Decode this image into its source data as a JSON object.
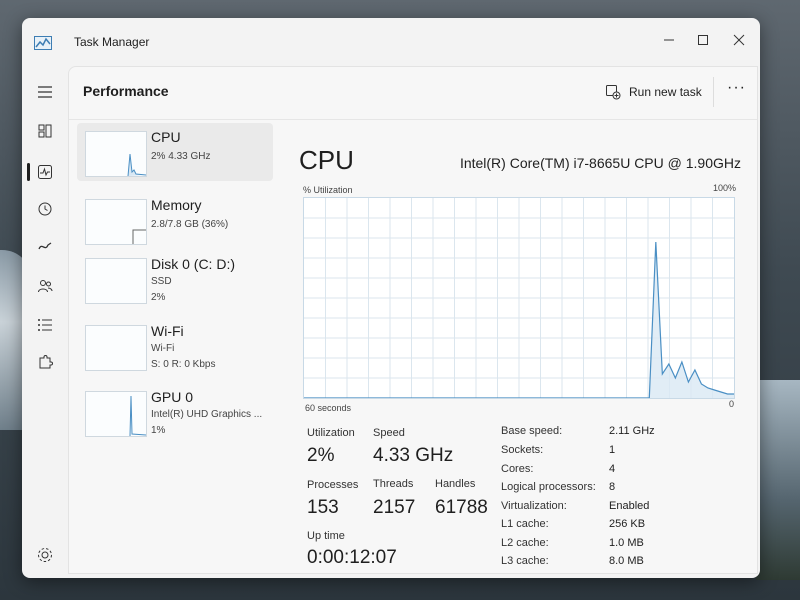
{
  "window": {
    "title": "Task Manager"
  },
  "command_bar": {
    "page_title": "Performance",
    "run_new_task": "Run new task",
    "more": "···"
  },
  "devices": [
    {
      "name": "CPU",
      "sub1": "2% 4.33 GHz",
      "sub2": "",
      "selected": true
    },
    {
      "name": "Memory",
      "sub1": "2.8/7.8 GB (36%)",
      "sub2": ""
    },
    {
      "name": "Disk 0 (C: D:)",
      "sub1": "SSD",
      "sub2": "2%"
    },
    {
      "name": "Wi-Fi",
      "sub1": "Wi-Fi",
      "sub2": "S: 0 R: 0 Kbps"
    },
    {
      "name": "GPU 0",
      "sub1": "Intel(R) UHD Graphics ...",
      "sub2": "1%"
    }
  ],
  "detail": {
    "title": "CPU",
    "model": "Intel(R) Core(TM) i7-8665U CPU @ 1.90GHz",
    "graph": {
      "y_label": "% Utilization",
      "y_max": "100%",
      "x_label": "60 seconds",
      "x_end": "0",
      "utilization_series": [
        0,
        0,
        0,
        0,
        0,
        0,
        0,
        0,
        0,
        0,
        0,
        0,
        0,
        0,
        0,
        0,
        0,
        0,
        0,
        0,
        0,
        0,
        0,
        0,
        0,
        0,
        0,
        0,
        0,
        0,
        0,
        0,
        0,
        0,
        0,
        0,
        0,
        0,
        0,
        0,
        0,
        0,
        0,
        0,
        0,
        0,
        0,
        0,
        0,
        0,
        0,
        0,
        0,
        0,
        78,
        12,
        17,
        10,
        18,
        8,
        14,
        7,
        5,
        4,
        3,
        2,
        2
      ]
    },
    "stats": {
      "utilization_label": "Utilization",
      "utilization": "2%",
      "speed_label": "Speed",
      "speed": "4.33 GHz",
      "processes_label": "Processes",
      "processes": "153",
      "threads_label": "Threads",
      "threads": "2157",
      "handles_label": "Handles",
      "handles": "61788",
      "uptime_label": "Up time",
      "uptime": "0:00:12:07"
    },
    "properties": [
      {
        "label": "Base speed:",
        "value": "2.11 GHz"
      },
      {
        "label": "Sockets:",
        "value": "1"
      },
      {
        "label": "Cores:",
        "value": "4"
      },
      {
        "label": "Logical processors:",
        "value": "8"
      },
      {
        "label": "Virtualization:",
        "value": "Enabled"
      },
      {
        "label": "L1 cache:",
        "value": "256 KB"
      },
      {
        "label": "L2 cache:",
        "value": "1.0 MB"
      },
      {
        "label": "L3 cache:",
        "value": "8.0 MB"
      }
    ]
  },
  "colors": {
    "graph_line": "#4a8fc4",
    "graph_fill": "#d9e8f4",
    "grid": "#dbe6ee"
  }
}
